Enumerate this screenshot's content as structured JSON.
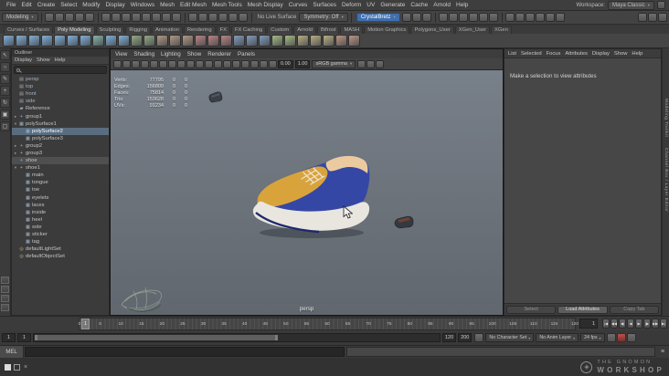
{
  "window": {
    "workspace_label": "Workspace:",
    "workspace_value": "Maya Classic"
  },
  "menubar": {
    "items": [
      "File",
      "Edit",
      "Create",
      "Select",
      "Modify",
      "Display",
      "Windows",
      "Mesh",
      "Edit Mesh",
      "Mesh Tools",
      "Mesh Display",
      "Curves",
      "Surfaces",
      "Deform",
      "UV",
      "Generate",
      "Cache",
      "Arnold",
      "Help"
    ]
  },
  "statusline": {
    "mode_selector": "Modeling",
    "file_icons": [
      "new-scene-icon",
      "open-scene-icon",
      "save-scene-icon",
      "undo-icon",
      "redo-icon"
    ],
    "selection_icons": [
      "select-hierarchy-icon",
      "select-object-icon",
      "select-component-icon",
      "select-mask-handles-icon",
      "select-mask-joints-icon",
      "select-mask-curves-icon",
      "select-mask-surfaces-icon",
      "select-mask-dynamics-icon"
    ],
    "snap_icons": [
      "snap-to-grid-icon",
      "snap-to-curve-icon",
      "snap-to-point-icon",
      "snap-to-projected-center-icon",
      "snap-to-view-plane-icon",
      "make-object-live-icon"
    ],
    "live_surface": "No Live Surface",
    "symmetry": "Symmetry: Off",
    "history_icons": [
      "input-connections-icon",
      "output-connections-icon",
      "construction-history-icon"
    ],
    "render_icons": [
      "open-render-view-icon",
      "render-current-frame-icon",
      "ipr-render-icon",
      "render-settings-icon",
      "hypershade-icon",
      "render-setup-icon"
    ],
    "custom_menu": "CrystalBretz",
    "right_icons": [
      "paint-effects-panel-icon",
      "grease-pencil-icon",
      "camera-gate-icon",
      "resolution-gate-icon",
      "gate-mask-icon",
      "field-chart-icon"
    ],
    "sidebar_icons": [
      "attribute-editor-toggle-icon",
      "tool-settings-toggle-icon",
      "channel-box-toggle-icon"
    ]
  },
  "shelf": {
    "tabs": [
      "Curves / Surfaces",
      "Poly Modeling",
      "Sculpting",
      "Rigging",
      "Animation",
      "Rendering",
      "FX",
      "FX Caching",
      "Custom",
      "Arnold",
      "Bifrost",
      "MASH",
      "Motion Graphics",
      "Polygons_User",
      "XGen_User",
      "XGen"
    ],
    "active_tab": "Poly Modeling",
    "icons": [
      {
        "name": "polygon-sphere-icon",
        "color": "#7fa6c9"
      },
      {
        "name": "polygon-cube-icon",
        "color": "#7fa6c9"
      },
      {
        "name": "polygon-cylinder-icon",
        "color": "#7fa6c9"
      },
      {
        "name": "polygon-cone-icon",
        "color": "#7fa6c9"
      },
      {
        "name": "polygon-torus-icon",
        "color": "#7fa6c9"
      },
      {
        "name": "polygon-plane-icon",
        "color": "#7fa6c9"
      },
      {
        "name": "polygon-disc-icon",
        "color": "#7fa6c9"
      },
      {
        "name": "platonic-solid-icon",
        "color": "#83a8a0"
      },
      {
        "name": "polygon-pipe-icon",
        "color": "#7fa6c9"
      },
      {
        "name": "polygon-helix-icon",
        "color": "#7fa6c9"
      },
      {
        "name": "polygon-gear-icon",
        "color": "#8fa07f"
      },
      {
        "name": "polygon-soccer-ball-icon",
        "color": "#8fa07f"
      },
      {
        "name": "super-ellipse-icon",
        "color": "#a8927f"
      },
      {
        "name": "spherical-harmonics-icon",
        "color": "#a8927f"
      },
      {
        "name": "ultra-shape-icon",
        "color": "#a8927f"
      },
      {
        "name": "boolean-union-icon",
        "color": "#b07f7f"
      },
      {
        "name": "boolean-difference-icon",
        "color": "#b07f7f"
      },
      {
        "name": "boolean-intersection-icon",
        "color": "#b07f7f"
      },
      {
        "name": "combine-icon",
        "color": "#7f94b0"
      },
      {
        "name": "separate-icon",
        "color": "#7f94b0"
      },
      {
        "name": "extract-icon",
        "color": "#7f94b0"
      },
      {
        "name": "fill-hole-icon",
        "color": "#9fb07f"
      },
      {
        "name": "smooth-icon",
        "color": "#9fb07f"
      },
      {
        "name": "append-to-polygon-icon",
        "color": "#b0a67f"
      },
      {
        "name": "bevel-icon",
        "color": "#b0a67f"
      },
      {
        "name": "bridge-icon",
        "color": "#b0a67f"
      },
      {
        "name": "extrude-icon",
        "color": "#b08f7f"
      },
      {
        "name": "multi-cut-icon",
        "color": "#b08f7f"
      }
    ]
  },
  "toolbox": {
    "tools": [
      {
        "name": "select-tool-icon",
        "glyph": "↖"
      },
      {
        "name": "lasso-select-tool-icon",
        "glyph": "○"
      },
      {
        "name": "paint-select-tool-icon",
        "glyph": "✎"
      },
      {
        "name": "move-tool-icon",
        "glyph": "+"
      },
      {
        "name": "rotate-tool-icon",
        "glyph": "↻"
      },
      {
        "name": "scale-tool-icon",
        "glyph": "▣"
      },
      {
        "name": "last-tool-icon",
        "glyph": "▢"
      }
    ],
    "layouts": [
      {
        "name": "single-pane-layout-icon"
      },
      {
        "name": "four-pane-layout-icon"
      },
      {
        "name": "persp-outliner-layout-icon"
      },
      {
        "name": "split-pane-layout-icon"
      }
    ]
  },
  "outliner": {
    "title": "Outliner",
    "menus": [
      "Display",
      "Show",
      "Help"
    ],
    "rows": [
      {
        "label": "persp",
        "icon": "camera",
        "depth": 0,
        "dim": true
      },
      {
        "label": "top",
        "icon": "camera",
        "depth": 0,
        "dim": true
      },
      {
        "label": "front",
        "icon": "camera",
        "depth": 0,
        "dim": true
      },
      {
        "label": "side",
        "icon": "camera",
        "depth": 0,
        "dim": true
      },
      {
        "label": "Reference",
        "icon": "folder",
        "depth": 0
      },
      {
        "label": "group1",
        "icon": "transform",
        "depth": 0,
        "expand": "collapsed"
      },
      {
        "label": "polySurface1",
        "icon": "mesh",
        "depth": 0,
        "expand": "expanded"
      },
      {
        "label": "polySurface2",
        "icon": "mesh",
        "depth": 1,
        "selected": true
      },
      {
        "label": "polySurface3",
        "icon": "mesh",
        "depth": 1
      },
      {
        "label": "group2",
        "icon": "transform",
        "depth": 0,
        "expand": "collapsed"
      },
      {
        "label": "group3",
        "icon": "transform",
        "depth": 0,
        "expand": "collapsed"
      },
      {
        "label": "shoe",
        "icon": "transform",
        "depth": 0,
        "highlight": true
      },
      {
        "label": "shoe1",
        "icon": "transform",
        "depth": 0,
        "expand": "expanded"
      },
      {
        "label": "main",
        "icon": "mesh",
        "depth": 1
      },
      {
        "label": "tongue",
        "icon": "mesh",
        "depth": 1
      },
      {
        "label": "toe",
        "icon": "mesh",
        "depth": 1
      },
      {
        "label": "eyelets",
        "icon": "mesh",
        "depth": 1
      },
      {
        "label": "laces",
        "icon": "mesh",
        "depth": 1
      },
      {
        "label": "inside",
        "icon": "mesh",
        "depth": 1
      },
      {
        "label": "heel",
        "icon": "mesh",
        "depth": 1
      },
      {
        "label": "sole",
        "icon": "mesh",
        "depth": 1
      },
      {
        "label": "sticker",
        "icon": "mesh",
        "depth": 1
      },
      {
        "label": "tag",
        "icon": "mesh",
        "depth": 1
      },
      {
        "label": "defaultLightSet",
        "icon": "set",
        "depth": 0
      },
      {
        "label": "defaultObjectSet",
        "icon": "set",
        "depth": 0
      }
    ]
  },
  "viewport": {
    "menus": [
      "View",
      "Shading",
      "Lighting",
      "Show",
      "Renderer",
      "Panels"
    ],
    "toolbar_icons": [
      "select-camera-icon",
      "lock-camera-icon",
      "camera-attributes-icon",
      "bookmark-icon",
      "image-plane-icon",
      "two-d-pan-zoom-icon",
      "oversampling-icon",
      "isolate-select-icon",
      "field-chart-icon",
      "resolution-gate-icon",
      "gate-mask-icon",
      "wireframe-icon",
      "shaded-icon",
      "textured-icon",
      "use-all-lights-icon",
      "shadows-icon",
      "screen-space-ao-icon",
      "motion-blur-icon"
    ],
    "toolbar_icons_right": [
      "anti-alias-icon",
      "depth-of-field-icon",
      "viewport-settings-icon"
    ],
    "exposure": "0.00",
    "gamma": "1.00",
    "view_transform": "sRGB gamma",
    "camera_label": "persp",
    "hud": [
      {
        "label": "Verts:",
        "total": "77795",
        "col2": "0",
        "col3": "0"
      },
      {
        "label": "Edges:",
        "total": "156809",
        "col2": "0",
        "col3": "0"
      },
      {
        "label": "Faces:",
        "total": "75814",
        "col2": "0",
        "col3": "0"
      },
      {
        "label": "Tris:",
        "total": "153628",
        "col2": "0",
        "col3": "0"
      },
      {
        "label": "UVs:",
        "total": "91234",
        "col2": "0",
        "col3": "0"
      }
    ]
  },
  "attribute_editor": {
    "tabs": [
      "List",
      "Selected",
      "Focus",
      "Attributes",
      "Display",
      "Show",
      "Help"
    ],
    "message": "Make a selection to view attributes",
    "buttons": [
      "Select",
      "Load Attributes",
      "Copy Tab"
    ]
  },
  "right_sidebar": {
    "tabs": [
      "Modeling Toolkit",
      "Channel Box / Layer Editor"
    ]
  },
  "time_slider": {
    "ticks": [
      "0",
      "5",
      "10",
      "15",
      "20",
      "25",
      "30",
      "35",
      "40",
      "45",
      "50",
      "55",
      "60",
      "65",
      "70",
      "75",
      "80",
      "85",
      "90",
      "95",
      "100",
      "105",
      "110",
      "115",
      "120"
    ],
    "current_frame": "1",
    "playback_icons": [
      {
        "name": "go-to-start-button",
        "glyph": "|◀"
      },
      {
        "name": "step-back-key-button",
        "glyph": "◀◀"
      },
      {
        "name": "step-back-frame-button",
        "glyph": "◀|"
      },
      {
        "name": "play-backwards-button",
        "glyph": "◀"
      },
      {
        "name": "play-forwards-button",
        "glyph": "▶"
      },
      {
        "name": "step-forward-frame-button",
        "glyph": "|▶"
      },
      {
        "name": "step-forward-key-button",
        "glyph": "▶▶"
      },
      {
        "name": "go-to-end-button",
        "glyph": "▶|"
      }
    ]
  },
  "range_slider": {
    "animation_start": "1",
    "playback_start": "1",
    "playback_end": "120",
    "animation_end": "200",
    "character_set": "No Character Set",
    "anim_layer": "No Anim Layer",
    "fps": "24 fps",
    "icons_left": [
      "playback-options-icon"
    ],
    "icons_right": [
      "set-key-icon",
      "auto-keyframe-toggle-icon",
      "animation-preferences-icon"
    ]
  },
  "command_line": {
    "label": "MEL"
  },
  "logo": {
    "line1": "THE GNOMON",
    "line2": "WORKSHOP"
  },
  "colors": {
    "shoe_blue": "#3547a5",
    "shoe_yellow": "#d9a33c",
    "shoe_collar": "#eccaa0",
    "shoe_sole": "#e9e6df",
    "shoe_stripe": "#1d2a6b",
    "shoe_laces": "#ece3cf",
    "custom_menu_bg": "#3f6fae"
  }
}
